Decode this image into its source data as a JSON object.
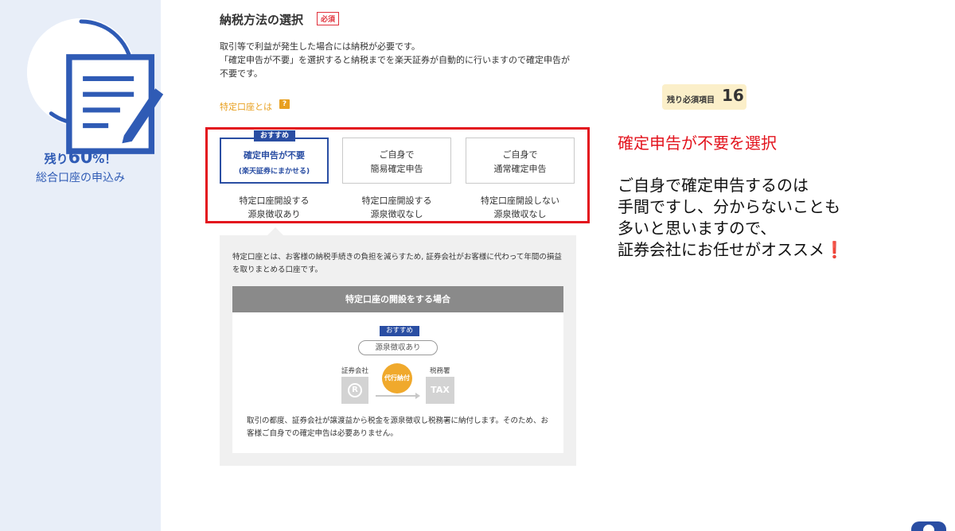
{
  "sidebar": {
    "progress_percent": 60,
    "remain_prefix": "残り",
    "remain_value": "60",
    "remain_suffix": "%！",
    "subtitle": "総合口座の申込み",
    "accent": "#2f5bb5"
  },
  "section": {
    "title": "納税方法の選択",
    "required_badge": "必須",
    "intro_line1": "取引等で利益が発生した場合には納税が必要です。",
    "intro_line2": "「確定申告が不要」を選択すると納税までを楽天証券が自動的に行いますので確定申告が不要です。",
    "tokutei_link": "特定口座とは",
    "help_icon_label": "?"
  },
  "remaining_tag": {
    "label": "残り必須項目",
    "count": "16"
  },
  "options": {
    "recommend_badge": "おすすめ",
    "items": [
      {
        "line1": "確定申告が不要",
        "line2": "(楽天証券にまかせる)",
        "desc1": "特定口座開設する",
        "desc2": "源泉徴収あり",
        "selected": true
      },
      {
        "line1": "ご自身で",
        "line2": "簡易確定申告",
        "desc1": "特定口座開設する",
        "desc2": "源泉徴収なし",
        "selected": false
      },
      {
        "line1": "ご自身で",
        "line2": "通常確定申告",
        "desc1": "特定口座開設しない",
        "desc2": "源泉徴収なし",
        "selected": false
      }
    ]
  },
  "annotation": {
    "headline": "確定申告が不要を選択",
    "line1": "ご自身で確定申告するのは",
    "line2": "手間ですし、分からないことも",
    "line3": "多いと思いますので、",
    "line4": "証券会社にお任せがオススメ",
    "excl": "❗",
    "color": "#e3131d"
  },
  "info": {
    "text": "特定口座とは、お客様の納税手続きの負担を減らすため, 証券会社がお客様に代わって年間の損益を取りまとめる口座です。",
    "case_title": "特定口座の開設をする場合",
    "case_recommend": "おすすめ",
    "case_pill": "源泉徴収あり",
    "broker_label": "証券会社",
    "broker_icon": "R",
    "tax_office_label": "税務署",
    "tax_icon": "TAX",
    "daikou_label": "代行納付",
    "case_text": "取引の都度、証券会社が譲渡益から税金を源泉徴収し税務署に納付します。そのため、お客様ご自身での確定申告は必要ありません。"
  }
}
